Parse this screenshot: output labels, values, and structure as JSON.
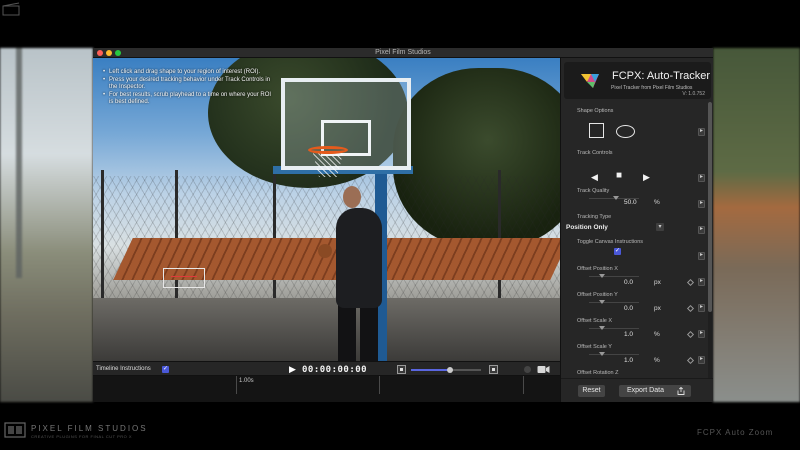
{
  "window": {
    "title": "Pixel Film Studios"
  },
  "viewer": {
    "instructions": [
      "Left click and drag shape to your region of interest (ROI).",
      "Press your desired tracking behavior under Track Controls in the Inspector.",
      "For best results, scrub playhead to a time on where your ROI is best defined."
    ]
  },
  "timeline": {
    "instructions_label": "Timeline Instructions",
    "instructions_checked": true,
    "timecode": "00:00:00:00",
    "ruler_label": "1.00s",
    "zoom_level": 0.55
  },
  "inspector": {
    "product_title": "FCPX: Auto-Tracker",
    "product_subtitle": "Pixel Tracker from Pixel Film Studios",
    "version": "V: 1.0.752",
    "shape_options_label": "Shape Options",
    "track_controls_label": "Track Controls",
    "track_quality_label": "Track Quality",
    "track_quality_value": "50.0",
    "track_quality_unit": "%",
    "tracking_type_label": "Tracking Type",
    "tracking_type_value": "Position Only",
    "toggle_canvas_label": "Toggle Canvas Instructions",
    "offset_position_x_label": "Offset Position X",
    "offset_position_x_value": "0.0",
    "offset_position_x_unit": "px",
    "offset_position_y_label": "Offset Position Y",
    "offset_position_y_value": "0.0",
    "offset_position_y_unit": "px",
    "offset_scale_x_label": "Offset Scale X",
    "offset_scale_x_value": "1.0",
    "offset_scale_x_unit": "%",
    "offset_scale_y_label": "Offset Scale Y",
    "offset_scale_y_value": "1.0",
    "offset_scale_y_unit": "%",
    "offset_rotation_z_label": "Offset Rotation Z",
    "reset_label": "Reset",
    "export_label": "Export Data"
  },
  "branding": {
    "left_name": "PIXEL FILM STUDIOS",
    "left_sub": "CREATIVE PLUGINS FOR FINAL CUT PRO X",
    "right_text": "FCPX Auto Zoom"
  },
  "colors": {
    "accent": "#4a58d8",
    "rim": "#e55b1c",
    "roi": "#e03a3a"
  }
}
